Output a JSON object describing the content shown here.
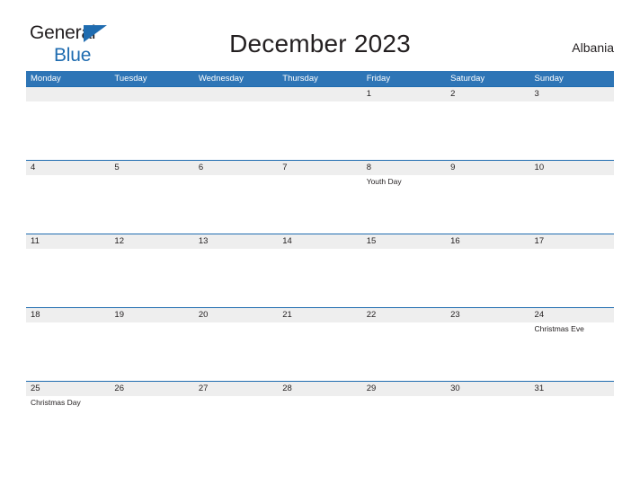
{
  "brand": {
    "name_part1": "General",
    "name_part2": "Blue",
    "triangle_icon": "triangle-icon",
    "accent_color": "#1f6cb0"
  },
  "header": {
    "title": "December 2023",
    "country": "Albania"
  },
  "colors": {
    "header_blue": "#2e75b6",
    "row_divider_blue": "#1f6cb0",
    "date_band_gray": "#eeeeee",
    "text": "#231f20"
  },
  "calendar": {
    "weekday_headers": [
      "Monday",
      "Tuesday",
      "Wednesday",
      "Thursday",
      "Friday",
      "Saturday",
      "Sunday"
    ],
    "weeks": [
      [
        {
          "date": "",
          "event": ""
        },
        {
          "date": "",
          "event": ""
        },
        {
          "date": "",
          "event": ""
        },
        {
          "date": "",
          "event": ""
        },
        {
          "date": "1",
          "event": ""
        },
        {
          "date": "2",
          "event": ""
        },
        {
          "date": "3",
          "event": ""
        }
      ],
      [
        {
          "date": "4",
          "event": ""
        },
        {
          "date": "5",
          "event": ""
        },
        {
          "date": "6",
          "event": ""
        },
        {
          "date": "7",
          "event": ""
        },
        {
          "date": "8",
          "event": "Youth Day"
        },
        {
          "date": "9",
          "event": ""
        },
        {
          "date": "10",
          "event": ""
        }
      ],
      [
        {
          "date": "11",
          "event": ""
        },
        {
          "date": "12",
          "event": ""
        },
        {
          "date": "13",
          "event": ""
        },
        {
          "date": "14",
          "event": ""
        },
        {
          "date": "15",
          "event": ""
        },
        {
          "date": "16",
          "event": ""
        },
        {
          "date": "17",
          "event": ""
        }
      ],
      [
        {
          "date": "18",
          "event": ""
        },
        {
          "date": "19",
          "event": ""
        },
        {
          "date": "20",
          "event": ""
        },
        {
          "date": "21",
          "event": ""
        },
        {
          "date": "22",
          "event": ""
        },
        {
          "date": "23",
          "event": ""
        },
        {
          "date": "24",
          "event": "Christmas Eve"
        }
      ],
      [
        {
          "date": "25",
          "event": "Christmas Day"
        },
        {
          "date": "26",
          "event": ""
        },
        {
          "date": "27",
          "event": ""
        },
        {
          "date": "28",
          "event": ""
        },
        {
          "date": "29",
          "event": ""
        },
        {
          "date": "30",
          "event": ""
        },
        {
          "date": "31",
          "event": ""
        }
      ]
    ]
  }
}
